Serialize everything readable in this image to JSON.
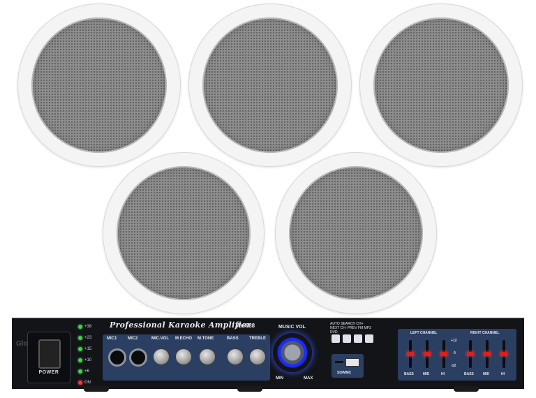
{
  "speakers": {
    "count": 5,
    "color_frame": "#f4f4f4",
    "color_grille": "#8d8d8d"
  },
  "amplifier": {
    "title": "Professional Karaoke Amplifier",
    "model": "AV-688",
    "power_label": "POWER",
    "led_labels": [
      "+38",
      "+23",
      "+15",
      "+10",
      "+6",
      "ON"
    ],
    "sections": {
      "mic1": "MIC1",
      "mic2": "MIC2",
      "mic_vol": "MIC.VOL",
      "m_echo": "M.ECHO",
      "m_tone": "M.TONE",
      "bass": "BASS",
      "treble": "TREBLE"
    },
    "music_vol": {
      "label": "MUSIC VOL",
      "min": "MIN",
      "max": "MAX"
    },
    "media_buttons": [
      "AUTO SEARCH",
      "CH+ NEXT",
      "CH- PREV",
      "FM MP3 DVD"
    ],
    "usb_label": "SD/MMC",
    "eq": {
      "left_channel": "LEFT CHANNEL",
      "right_channel": "RIGHT CHANNEL",
      "bands": [
        "BASS",
        "MID",
        "HI",
        "BASS",
        "MID",
        "HI"
      ],
      "scale_top": "+12",
      "scale_mid": "0",
      "scale_bot": "-12"
    },
    "accent_led_green": "#46d04a",
    "accent_vol_blue": "#1a2bff",
    "accent_eq_red": "#e11d1d"
  },
  "watermark": "Globalink"
}
